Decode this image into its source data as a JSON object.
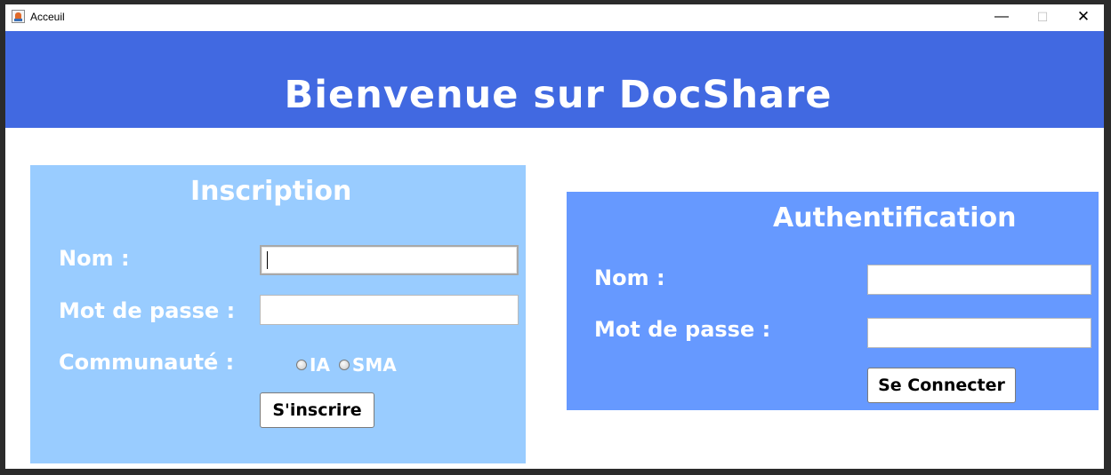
{
  "window": {
    "title": "Acceuil",
    "minimize_glyph": "—",
    "maximize_glyph": "☐",
    "close_glyph": "✕"
  },
  "header": {
    "title": "Bienvenue sur DocShare",
    "background": "#4169e1"
  },
  "inscription": {
    "title": "Inscription",
    "name_label": "Nom :",
    "name_value": "",
    "password_label": "Mot de passe :",
    "password_value": "",
    "community_label": "Communauté :",
    "community_options": [
      {
        "label": "IA",
        "selected": false
      },
      {
        "label": "SMA",
        "selected": false
      }
    ],
    "submit_label": "S'inscrire",
    "background": "#99ccff"
  },
  "authentification": {
    "title": "Authentification",
    "name_label": "Nom :",
    "name_value": "",
    "password_label": "Mot de passe :",
    "password_value": "",
    "submit_label": "Se Connecter",
    "background": "#6699ff"
  }
}
